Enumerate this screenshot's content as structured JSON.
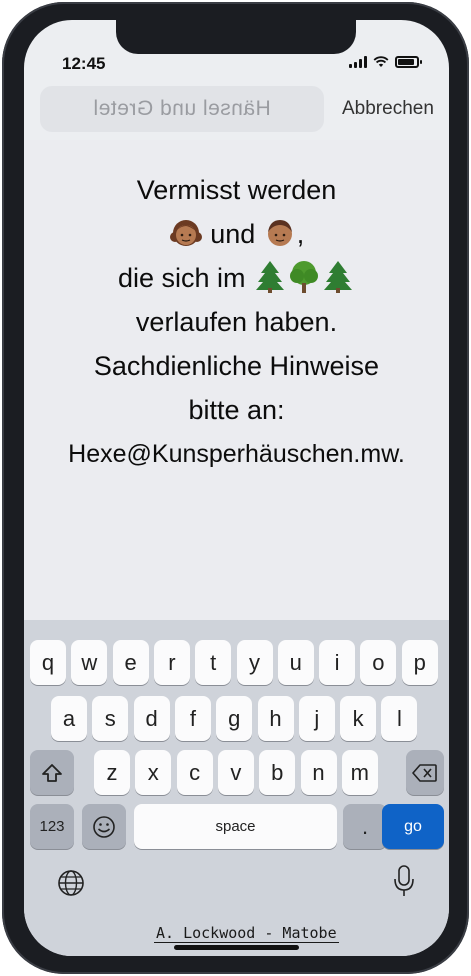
{
  "status_bar": {
    "time": "12:45"
  },
  "search": {
    "value": "Hänsel und Gretel",
    "cancel_label": "Abbrechen"
  },
  "message": {
    "line1": "Vermisst werden",
    "line2_connector": "und",
    "line2_suffix": ",",
    "line3_prefix": "die sich im",
    "line4": "verlaufen haben.",
    "line5": "Sachdienliche Hinweise",
    "line6": "bitte an:",
    "line7": "Hexe@Kunsperhäuschen.mw."
  },
  "emoji": {
    "girl": "girl-emoji",
    "boy": "boy-emoji",
    "trees": [
      "evergreen-tree-emoji",
      "deciduous-tree-emoji",
      "evergreen-tree-emoji"
    ]
  },
  "keyboard": {
    "row1": [
      "q",
      "w",
      "e",
      "r",
      "t",
      "y",
      "u",
      "i",
      "o",
      "p"
    ],
    "row2": [
      "a",
      "s",
      "d",
      "f",
      "g",
      "h",
      "j",
      "k",
      "l"
    ],
    "row3": [
      "z",
      "x",
      "c",
      "v",
      "b",
      "n",
      "m"
    ],
    "numbers_label": "123",
    "space_label": "space",
    "dot_label": ".",
    "go_label": "go"
  },
  "credit": "A. Lockwood - Matobe",
  "colors": {
    "go_key": "#0f63c7",
    "screen_bg": "#ebecf0",
    "keyboard_bg": "#cfd3da"
  }
}
